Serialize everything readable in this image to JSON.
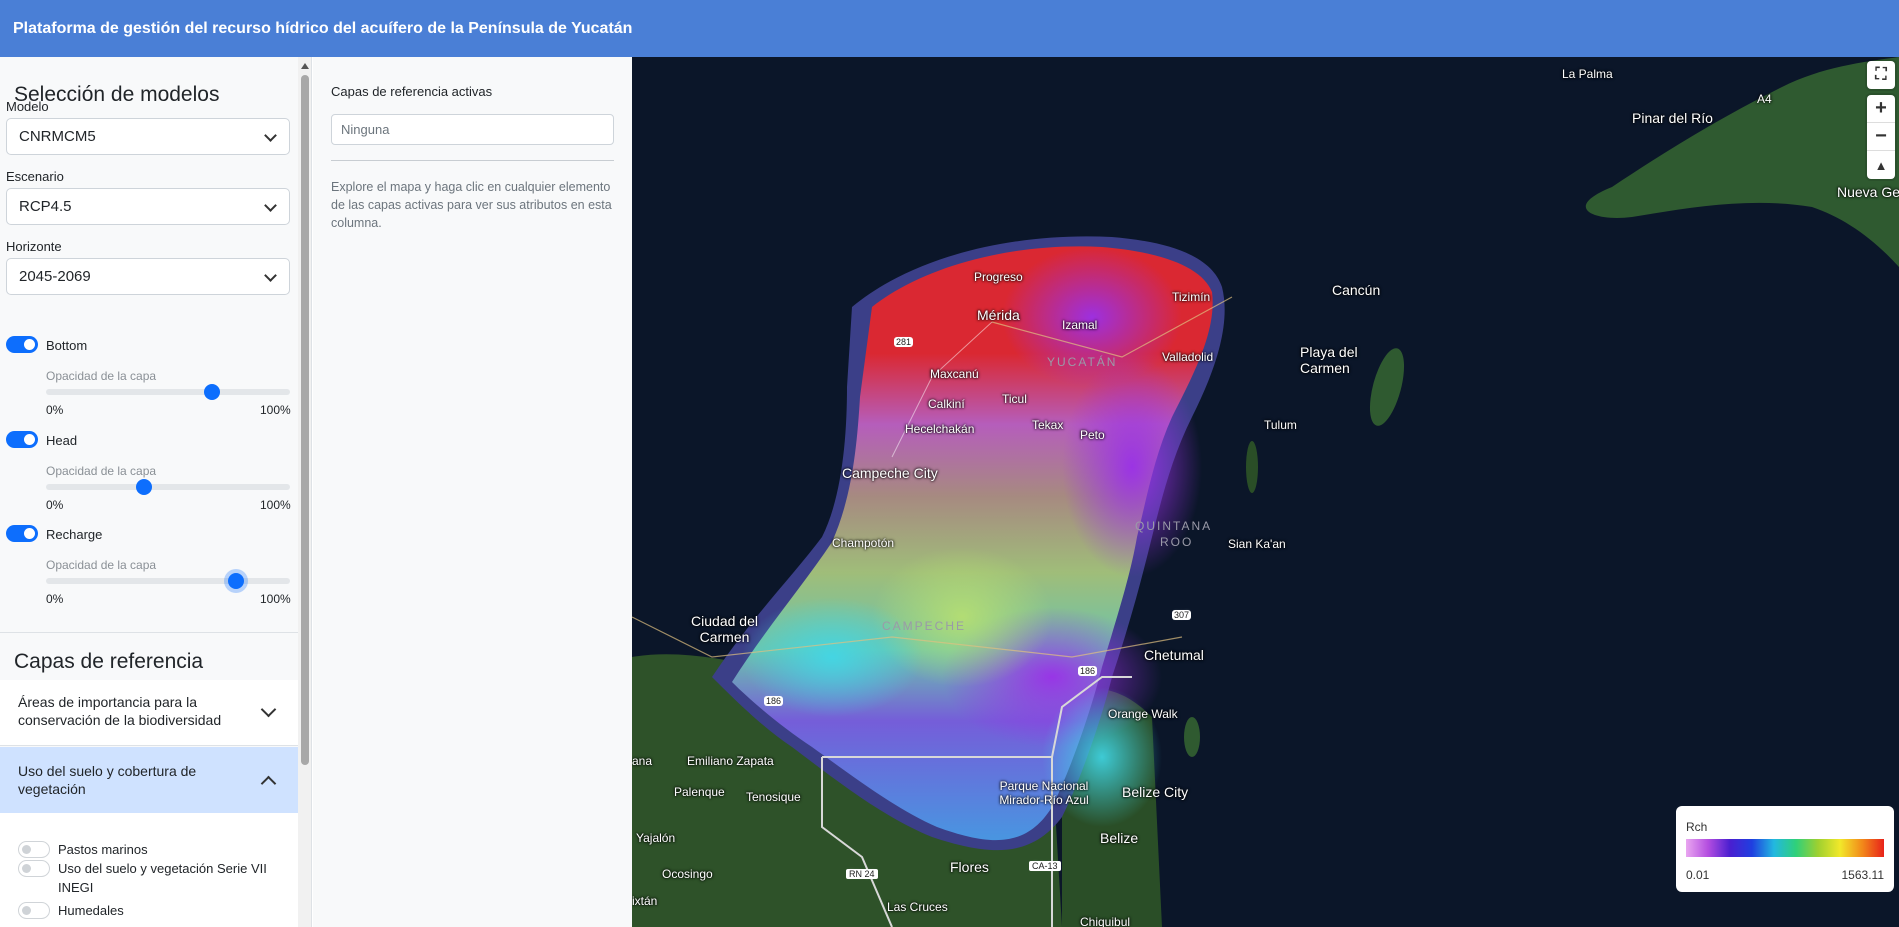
{
  "header": {
    "title": "Plataforma de gestión del recurso hídrico del acuífero de la Península de Yucatán"
  },
  "models": {
    "heading": "Selección de modelos",
    "model_label": "Modelo",
    "model_value": "CNRMCM5",
    "scenario_label": "Escenario",
    "scenario_value": "RCP4.5",
    "horizon_label": "Horizonte",
    "horizon_value": "2045-2069"
  },
  "layers": [
    {
      "label": "Bottom",
      "enabled": true,
      "opacity_label": "Opacidad de la capa",
      "opacity": 0.68,
      "min": "0%",
      "max": "100%"
    },
    {
      "label": "Head",
      "enabled": true,
      "opacity_label": "Opacidad de la capa",
      "opacity": 0.4,
      "min": "0%",
      "max": "100%"
    },
    {
      "label": "Recharge",
      "enabled": true,
      "opacity_label": "Opacidad de la capa",
      "opacity": 0.78,
      "min": "0%",
      "max": "100%"
    }
  ],
  "reference": {
    "heading": "Capas de referencia",
    "sections": [
      {
        "label": "Áreas de importancia para la conservación de la biodiversidad",
        "expanded": false
      },
      {
        "label": "Uso del suelo y cobertura de vegetación",
        "expanded": true
      }
    ],
    "items": [
      {
        "label": "Pastos marinos",
        "enabled": false
      },
      {
        "label": "Uso del suelo y vegetación Serie VII INEGI",
        "enabled": false
      },
      {
        "label": "Humedales",
        "enabled": false
      }
    ]
  },
  "attributes": {
    "title": "Capas de referencia activas",
    "active_value": "Ninguna",
    "help": "Explore el mapa y haga clic en cualquier elemento de las capas activas para ver sus atributos en esta columna."
  },
  "map": {
    "controls": [
      "expand-icon",
      "zoom-in-icon",
      "zoom-out-icon",
      "compass-icon"
    ],
    "labels": {
      "la_palma": "La Palma",
      "pinar": "Pinar del Río",
      "nueva_ger": "Nueva Ger",
      "progreso": "Progreso",
      "merida": "Mérida",
      "izamal": "Izamal",
      "tizimin": "Tizimín",
      "cancun": "Cancún",
      "yucatan": "YUCATÁN",
      "valladolid": "Valladolid",
      "playa": "Playa del Carmen",
      "maxcanu": "Maxcanú",
      "calkini": "Calkiní",
      "ticul": "Ticul",
      "tekax": "Tekax",
      "peto": "Peto",
      "hecelchakan": "Hecelchakán",
      "tulum": "Tulum",
      "campeche_city": "Campeche City",
      "quintana": "QUINTANA",
      "roo": "ROO",
      "siankaan": "Sian Ka'an",
      "champoton": "Champotón",
      "cd_carmen": "Ciudad del Carmen",
      "campeche": "CAMPECHE",
      "chetumal": "Chetumal",
      "orange": "Orange Walk",
      "emiliano": "Emiliano Zapata",
      "palenque": "Palenque",
      "tenosique": "Tenosique",
      "parque": "Parque Nacional Mirador-Río Azul",
      "belize_city": "Belize City",
      "belize": "Belize",
      "flores": "Flores",
      "yajalon": "Yajalón",
      "ocosingo": "Ocosingo",
      "las_cruces": "Las Cruces",
      "chiquibul": "Chiquibul",
      "ixtan": "ixtán",
      "ana": "ana",
      "r281": "281",
      "r186a": "186",
      "r186b": "186",
      "r307": "307",
      "rn24": "RN 24",
      "ca13": "CA-13",
      "a4": "A4"
    }
  },
  "legend": {
    "title": "Rch",
    "min": "0.01",
    "max": "1563.11"
  },
  "colors": {
    "header": "#4a7fd6",
    "accent": "#0d6efd",
    "active_section": "#cfe2ff"
  }
}
